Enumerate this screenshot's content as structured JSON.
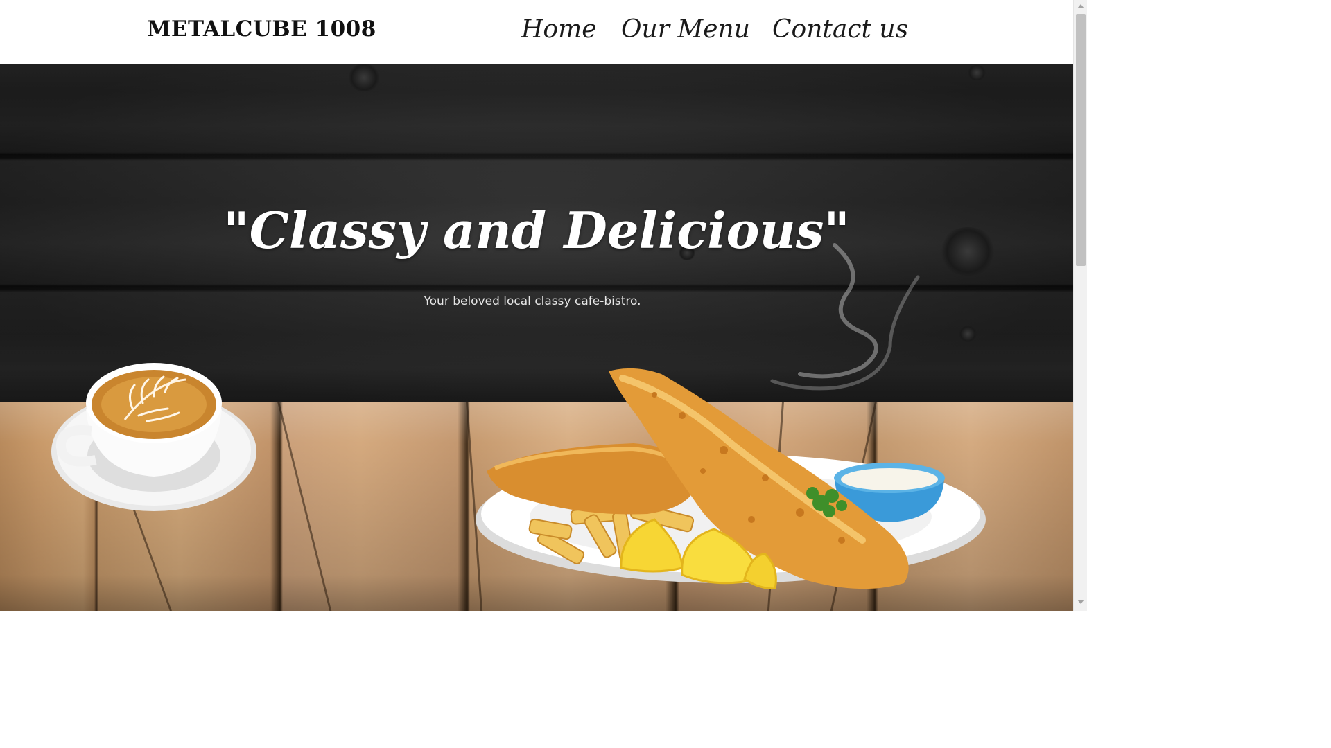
{
  "navbar": {
    "brand": "METALCUBE 1008",
    "links": [
      {
        "label": "Home"
      },
      {
        "label": "Our Menu"
      },
      {
        "label": "Contact us"
      }
    ]
  },
  "hero": {
    "title": "\"Classy and Delicious\"",
    "subtitle": "Your beloved local classy cafe-bistro.",
    "images": [
      {
        "icon": "coffee-cup-icon"
      },
      {
        "icon": "fish-and-chips-icon"
      }
    ]
  },
  "colors": {
    "navbar_bg": "#ffffff",
    "wall": "#262626",
    "wood": "#c99a6a",
    "text_light": "#ffffff"
  }
}
